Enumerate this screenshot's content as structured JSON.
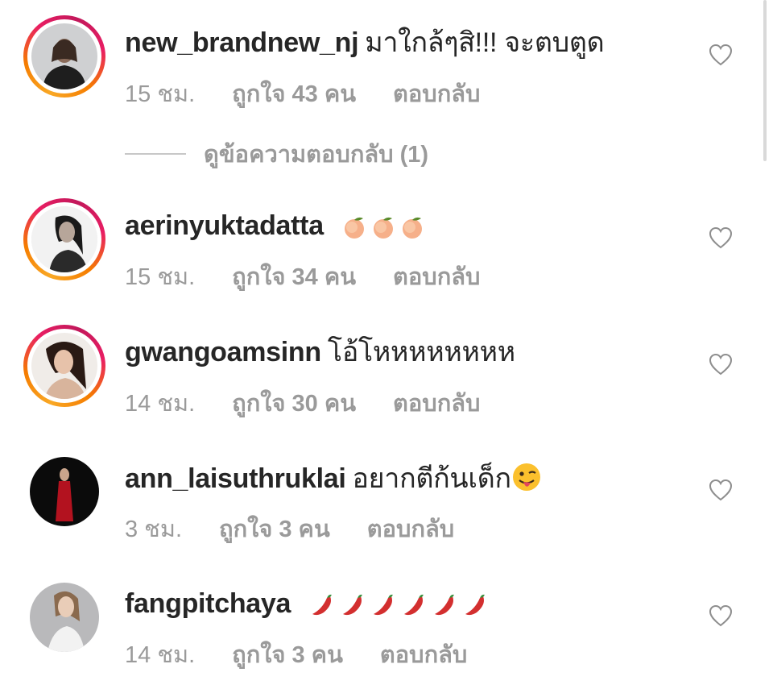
{
  "comments": [
    {
      "username": "new_brandnew_nj",
      "text": "มาใกล้ๆสิ!!! จะตบตูด",
      "time": "15 ชม.",
      "likes": "ถูกใจ 43 คน",
      "reply": "ตอบกลับ",
      "has_story_ring": true,
      "emoji": []
    },
    {
      "username": "aerinyuktadatta",
      "text": "",
      "time": "15 ชม.",
      "likes": "ถูกใจ 34 คน",
      "reply": "ตอบกลับ",
      "has_story_ring": true,
      "emoji": [
        "peach-emoji",
        "peach-emoji",
        "peach-emoji"
      ]
    },
    {
      "username": "gwangoamsinn",
      "text": "โอ้โหหหหหหหห",
      "time": "14 ชม.",
      "likes": "ถูกใจ 30 คน",
      "reply": "ตอบกลับ",
      "has_story_ring": true,
      "emoji": []
    },
    {
      "username": "ann_laisuthruklai",
      "text": "อยากตีก้นเด็ก",
      "time": "3 ชม.",
      "likes": "ถูกใจ 3 คน",
      "reply": "ตอบกลับ",
      "has_story_ring": false,
      "emoji": [
        "winking-tongue-emoji"
      ]
    },
    {
      "username": "fangpitchaya",
      "text": "",
      "time": "14 ชม.",
      "likes": "ถูกใจ 3 คน",
      "reply": "ตอบกลับ",
      "has_story_ring": false,
      "emoji": [
        "hot-pepper-emoji",
        "hot-pepper-emoji",
        "hot-pepper-emoji",
        "hot-pepper-emoji",
        "hot-pepper-emoji",
        "hot-pepper-emoji"
      ]
    }
  ],
  "view_replies": "ดูข้อความตอบกลับ (1)",
  "colors": {
    "text": "#262626",
    "meta": "#9a9a9a",
    "divider": "#c7c7c7",
    "ring_start": "#f9a825",
    "ring_end": "#c2185b"
  },
  "icons": {
    "like": "heart-outline-icon"
  }
}
